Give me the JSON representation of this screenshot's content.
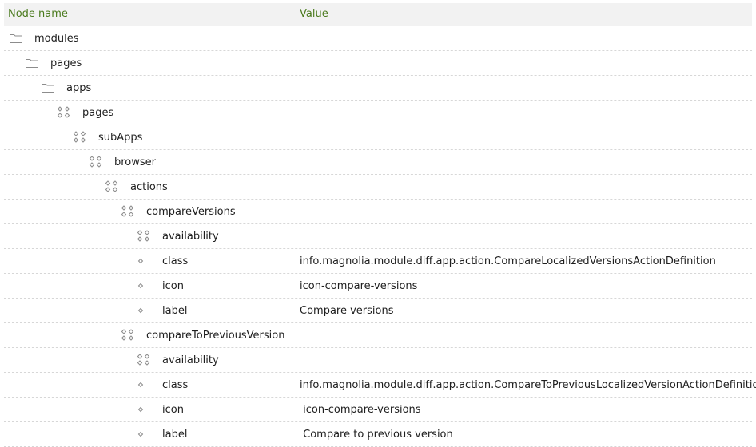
{
  "columns": {
    "name": "Node name",
    "value": "Value"
  },
  "rows": [
    {
      "name": "modules",
      "value": "",
      "depth": 0,
      "icon": "folder-icon"
    },
    {
      "name": "pages",
      "value": "",
      "depth": 1,
      "icon": "folder-icon"
    },
    {
      "name": "apps",
      "value": "",
      "depth": 2,
      "icon": "folder-icon"
    },
    {
      "name": "pages",
      "value": "",
      "depth": 3,
      "icon": "content-node-icon"
    },
    {
      "name": "subApps",
      "value": "",
      "depth": 4,
      "icon": "content-node-icon"
    },
    {
      "name": "browser",
      "value": "",
      "depth": 5,
      "icon": "content-node-icon"
    },
    {
      "name": "actions",
      "value": "",
      "depth": 6,
      "icon": "content-node-icon"
    },
    {
      "name": "compareVersions",
      "value": "",
      "depth": 7,
      "icon": "content-node-icon"
    },
    {
      "name": "availability",
      "value": "",
      "depth": 8,
      "icon": "content-node-icon"
    },
    {
      "name": "class",
      "value": "info.magnolia.module.diff.app.action.CompareLocalizedVersionsActionDefinition",
      "depth": 8,
      "icon": "property-icon"
    },
    {
      "name": "icon",
      "value": "icon-compare-versions",
      "depth": 8,
      "icon": "property-icon"
    },
    {
      "name": "label",
      "value": "Compare versions",
      "depth": 8,
      "icon": "property-icon"
    },
    {
      "name": "compareToPreviousVersion",
      "value": "",
      "depth": 7,
      "icon": "content-node-icon"
    },
    {
      "name": "availability",
      "value": "",
      "depth": 8,
      "icon": "content-node-icon"
    },
    {
      "name": "class",
      "value": "info.magnolia.module.diff.app.action.CompareToPreviousLocalizedVersionActionDefinition",
      "depth": 8,
      "icon": "property-icon"
    },
    {
      "name": "icon",
      "value": " icon-compare-versions",
      "depth": 8,
      "icon": "property-icon"
    },
    {
      "name": "label",
      "value": " Compare to previous version",
      "depth": 8,
      "icon": "property-icon"
    }
  ]
}
